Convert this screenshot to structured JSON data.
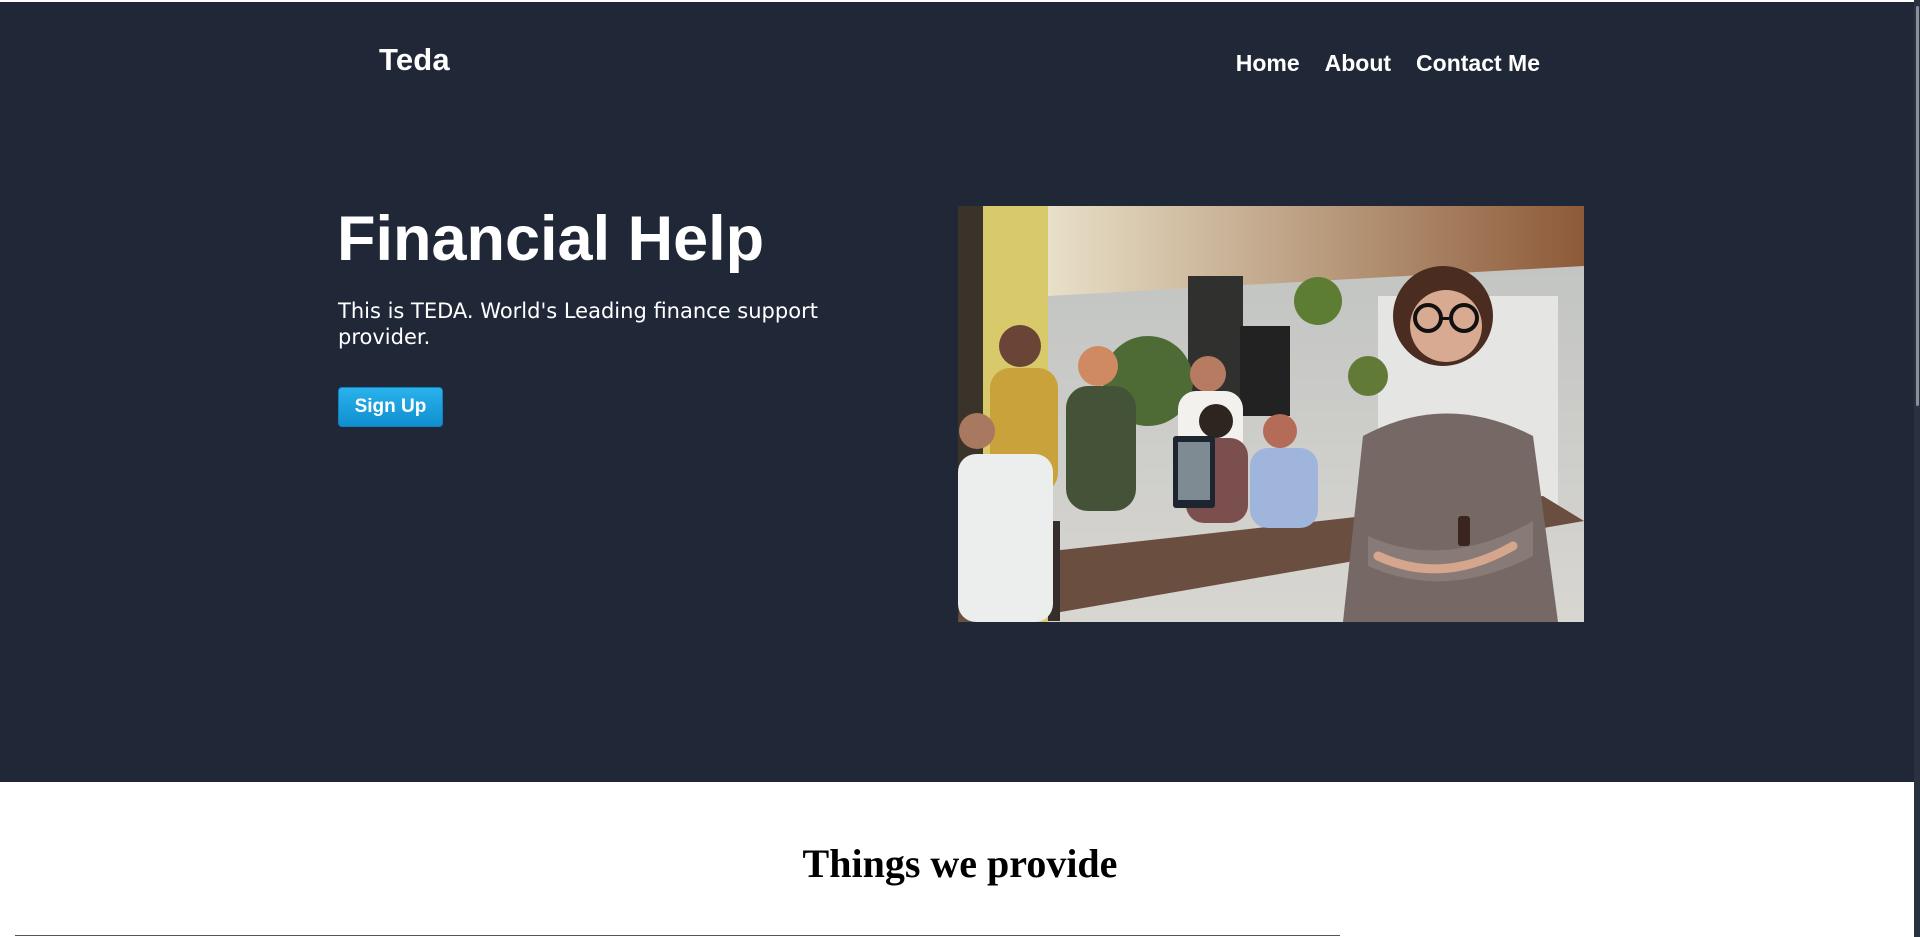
{
  "header": {
    "brand": "Teda",
    "nav": [
      "Home",
      "About",
      "Contact Me"
    ]
  },
  "hero": {
    "title": "Financial Help",
    "description": "This is TEDA. World's Leading finance support provider.",
    "signup_label": "Sign Up",
    "image": "team-office-photo"
  },
  "section": {
    "title": "Things we provide"
  },
  "colors": {
    "hero_background": "#202838",
    "button_blue": "#1aa3e1",
    "text_light": "#ffffff"
  }
}
